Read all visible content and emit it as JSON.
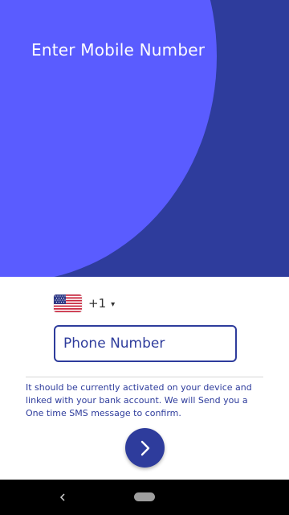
{
  "header": {
    "title": "Enter Mobile Number"
  },
  "country_selector": {
    "flag_icon": "us-flag-icon",
    "dial_code": "+1",
    "caret_icon": "dropdown-caret-icon"
  },
  "phone_input": {
    "placeholder": "Phone Number",
    "value": ""
  },
  "info_text": "It should be currently activated on your device and linked with your bank account. We will Send you a One time SMS message to confirm.",
  "next_button": {
    "icon": "chevron-right-icon"
  },
  "nav_bar": {
    "back_icon": "back-triangle-icon",
    "home_icon": "home-pill-icon"
  },
  "colors": {
    "primary": "#2e3c9c",
    "accent_circle": "#5a5cff",
    "background": "#ffffff"
  }
}
